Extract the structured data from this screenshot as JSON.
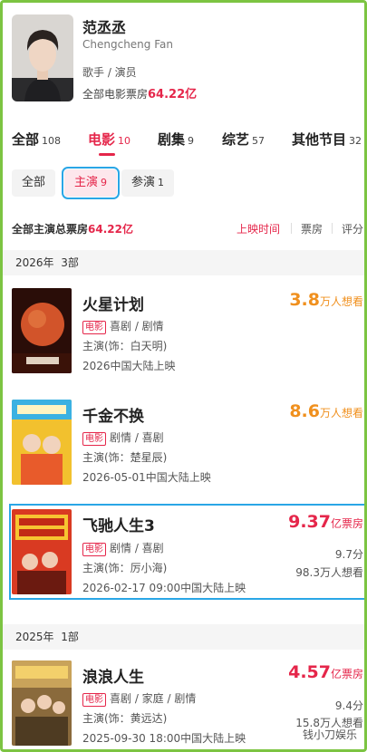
{
  "artist": {
    "name": "范丞丞",
    "name_en": "Chengcheng Fan",
    "roles": "歌手 / 演员",
    "box_label": "全部电影票房",
    "box_value": "64.22亿"
  },
  "tabs": [
    {
      "label": "全部",
      "count": "108",
      "active": false
    },
    {
      "label": "电影",
      "count": "10",
      "active": true
    },
    {
      "label": "剧集",
      "count": "9",
      "active": false
    },
    {
      "label": "综艺",
      "count": "57",
      "active": false
    },
    {
      "label": "其他节目",
      "count": "32",
      "active": false
    }
  ],
  "filters": [
    {
      "label": "全部",
      "count": ""
    },
    {
      "label": "主演",
      "count": "9"
    },
    {
      "label": "参演",
      "count": "1"
    }
  ],
  "summary": {
    "label": "全部主演总票房",
    "value": "64.22亿"
  },
  "sort_options": [
    "上映时间",
    "票房",
    "评分"
  ],
  "years": [
    {
      "label": "2026年",
      "count": "3部"
    },
    {
      "label": "2025年",
      "count": "1部"
    }
  ],
  "movies": [
    {
      "title": "火星计划",
      "metric_value": "3.8",
      "metric_unit": "万人想看",
      "tag": "电影",
      "genres": "喜剧 / 剧情",
      "role": "主演(饰：白天明)",
      "release": "2026中国大陆上映",
      "score": "",
      "want": ""
    },
    {
      "title": "千金不换",
      "metric_value": "8.6",
      "metric_unit": "万人想看",
      "tag": "电影",
      "genres": "剧情 / 喜剧",
      "role": "主演(饰：楚星辰)",
      "release": "2026-05-01中国大陆上映",
      "score": "",
      "want": ""
    },
    {
      "title": "飞驰人生3",
      "metric_value": "9.37",
      "metric_unit": "亿票房",
      "tag": "电影",
      "genres": "剧情 / 喜剧",
      "role": "主演(饰：厉小海)",
      "release": "2026-02-17 09:00中国大陆上映",
      "score": "9.7分",
      "want": "98.3万人想看"
    },
    {
      "title": "浪浪人生",
      "metric_value": "4.57",
      "metric_unit": "亿票房",
      "tag": "电影",
      "genres": "喜剧 / 家庭 / 剧情",
      "role": "主演(饰：黄远达)",
      "release": "2025-09-30 18:00中国大陆上映",
      "score": "9.4分",
      "want": "15.8万人想看"
    }
  ],
  "watermark": "钱小刀娱乐"
}
